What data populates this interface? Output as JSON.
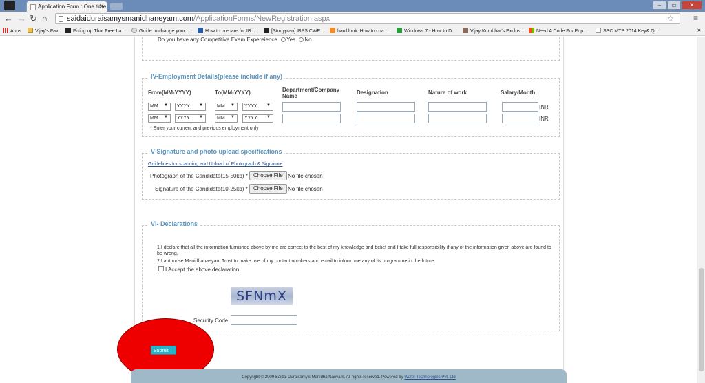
{
  "browser": {
    "tab_title": "Application Form : One time I",
    "url_host": "saidaiduraisamysmanidhaneyam.com",
    "url_path": "/ApplicationForms/NewRegistration.aspx",
    "bookmarks": [
      "Apps",
      "Vijay's Fav",
      "Fixing up That Free La...",
      "Guide to change your ...",
      "How to prepare for IB...",
      "[Studyplan] IBPS CWE...",
      "hard look: How to cha...",
      "Windows 7 - How to D...",
      "Vijay Kumbhar's Exclus...",
      "Need A Code For Pop...",
      "SSC MTS 2014 Key& Q..."
    ]
  },
  "competitive": {
    "question": "Do you have any Competitive Exam Expereience",
    "yes": "Yes",
    "no": "No"
  },
  "employment": {
    "legend": "IV-Employment Details(please include if any)",
    "headers": {
      "from": "From(MM-YYYY)",
      "to": "To(MM-YYYY)",
      "department": "Department/Company Name",
      "designation": "Designation",
      "nature": "Nature of work",
      "salary": "Salary/Month"
    },
    "month_placeholder": "MM",
    "year_placeholder": "YYYY",
    "currency": "INR",
    "note": "* Enter your current and previous employment only"
  },
  "signature": {
    "legend": "V-Signature and photo upload specifications",
    "guidelines_link": "Guidelines for scanning and Upload of Photograph & Signature",
    "photo_label": "Photograph of the Candidate(15-50kb) *",
    "sign_label": "Signature of the Candidate(10-25kb) *",
    "choose_file": "Choose File",
    "no_file": "No file chosen"
  },
  "declarations": {
    "legend": "VI- Declarations",
    "line1": "1.I declare that all the information furnished above by me are correct to the best of my knowledge and belief and I take full responsibility if any of the information given above are found to be wrong.",
    "line2": "2.I authorise Manidhanaeyam Trust to make use of my contact numbers and email to inform me any of its programme in the future.",
    "accept_label": "I Accept the above declaration",
    "captcha_text": "SFNmX",
    "security_code_label": "Security Code"
  },
  "submit_label": "Submit",
  "footer": {
    "copyright": "Copyright © 2009 Saidai Duraisamy's Manidha Naeyam. All rights reserved. Powered by ",
    "company": "Wafer Technologies Pvt. Ltd"
  }
}
